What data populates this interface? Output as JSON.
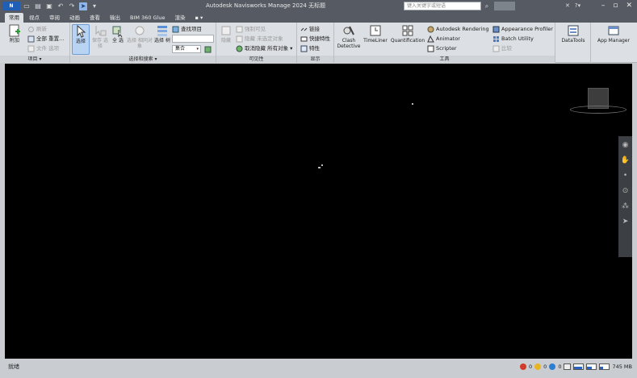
{
  "titlebar": {
    "app_logo": "N",
    "title": "Autodesk Navisworks Manage 2024   无标题",
    "search_placeholder": "键入关键字或短语",
    "qat_icons": [
      "new-icon",
      "open-icon",
      "save-icon",
      "undo-icon",
      "redo-icon",
      "select-cursor-icon",
      "customize-icon"
    ],
    "window_controls": [
      "minimize-icon",
      "maximize-icon",
      "close-icon"
    ]
  },
  "tabs": [
    "常用",
    "视点",
    "审阅",
    "动画",
    "查看",
    "输出",
    "BIM 360 Glue",
    "渲染",
    "▪ ▾"
  ],
  "ribbon": {
    "project": {
      "label": "项目 ▾",
      "append": "附加",
      "refresh": "刷新",
      "reset_all": "全部 重置...",
      "file_options": "文件 选项"
    },
    "select_search": {
      "label": "选择和搜索 ▾",
      "select": "选择",
      "save_selection": "保存 选择",
      "select_all": "全 选",
      "select_same": "选择 相同对象",
      "selection_tree": "选择 树",
      "find_items": "查找项目",
      "quick_find_placeholder": "",
      "sets_combo": "集合"
    },
    "visibility": {
      "label": "可见性",
      "hide": "隐藏",
      "require": "强制可见",
      "hide_unselected": "隐藏 未选定对象",
      "unhide_all": "取消隐藏 所有对象"
    },
    "display": {
      "label": "显示",
      "links": "链接",
      "quick_properties": "快捷特性",
      "properties": "特性"
    },
    "tools": {
      "label": "工具",
      "clash_detective": "Clash Detective",
      "timeliner": "TimeLiner",
      "quantification": "Quantification",
      "autodesk_rendering": "Autodesk Rendering",
      "animator": "Animator",
      "scripter": "Scripter",
      "appearance_profiler": "Appearance Profiler",
      "batch_utility": "Batch Utility",
      "compare": "比较"
    },
    "datatools": "DataTools",
    "app_manager": "App Manager"
  },
  "navbar_icons": [
    "steering-wheel-icon",
    "pan-icon",
    "zoom-icon",
    "orbit-icon",
    "look-icon",
    "select-icon"
  ],
  "status": {
    "left_text": "就绪",
    "warnings": [
      "0",
      "0",
      "0"
    ],
    "memory": "745 MB"
  },
  "colors": {
    "title_bar": "#565b63",
    "ribbon": "#dcdfe3",
    "viewport": "#000000",
    "accent": "#2b62c2"
  }
}
